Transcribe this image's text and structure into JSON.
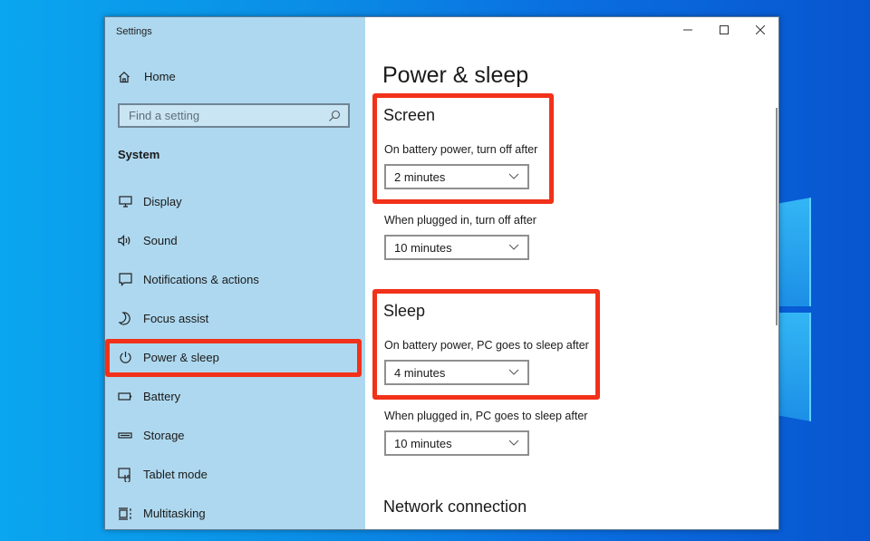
{
  "window": {
    "app_title": "Settings",
    "controls": {
      "minimize": "minimize-icon",
      "maximize": "maximize-icon",
      "close": "close-icon"
    }
  },
  "sidebar": {
    "home_label": "Home",
    "home_icon": "home-icon",
    "search": {
      "placeholder": "Find a setting",
      "value": "",
      "icon": "search-icon"
    },
    "section_label": "System",
    "items": [
      {
        "label": "Display",
        "icon": "display-icon",
        "active": false
      },
      {
        "label": "Sound",
        "icon": "sound-icon",
        "active": false
      },
      {
        "label": "Notifications & actions",
        "icon": "notifications-icon",
        "active": false
      },
      {
        "label": "Focus assist",
        "icon": "moon-icon",
        "active": false
      },
      {
        "label": "Power & sleep",
        "icon": "power-icon",
        "active": true
      },
      {
        "label": "Battery",
        "icon": "battery-icon",
        "active": false
      },
      {
        "label": "Storage",
        "icon": "storage-icon",
        "active": false
      },
      {
        "label": "Tablet mode",
        "icon": "tablet-mode-icon",
        "active": false
      },
      {
        "label": "Multitasking",
        "icon": "multitasking-icon",
        "active": false
      }
    ]
  },
  "main": {
    "page_title": "Power & sleep",
    "screen": {
      "title": "Screen",
      "battery_label": "On battery power, turn off after",
      "battery_value": "2 minutes",
      "plugged_label": "When plugged in, turn off after",
      "plugged_value": "10 minutes"
    },
    "sleep": {
      "title": "Sleep",
      "battery_label": "On battery power, PC goes to sleep after",
      "battery_value": "4 minutes",
      "plugged_label": "When plugged in, PC goes to sleep after",
      "plugged_value": "10 minutes"
    },
    "network": {
      "title": "Network connection"
    }
  },
  "colors": {
    "highlight": "#f2311a",
    "sidebar_bg": "#aed8ef",
    "desktop_blue": "#0a8ee6"
  }
}
